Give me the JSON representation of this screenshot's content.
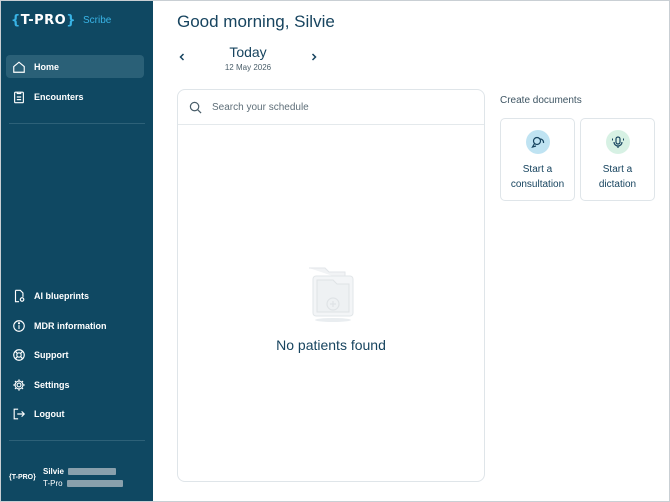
{
  "brand": {
    "logo": "T-PRO",
    "product": "Scribe"
  },
  "sidebar": {
    "top_items": [
      {
        "label": "Home",
        "icon": "home-icon",
        "active": true
      },
      {
        "label": "Encounters",
        "icon": "clipboard-icon",
        "active": false
      }
    ],
    "bottom_items": [
      {
        "label": "AI blueprints",
        "icon": "document-gear-icon"
      },
      {
        "label": "MDR information",
        "icon": "info-icon"
      },
      {
        "label": "Support",
        "icon": "lifebuoy-icon"
      },
      {
        "label": "Settings",
        "icon": "gear-icon"
      },
      {
        "label": "Logout",
        "icon": "logout-icon"
      }
    ],
    "user": {
      "logo": "T-PRO",
      "name": "Silvie",
      "org": "T-Pro"
    }
  },
  "header": {
    "greeting": "Good morning, Silvie"
  },
  "date_nav": {
    "title": "Today",
    "date": "12 May 2026"
  },
  "schedule": {
    "search_placeholder": "Search your schedule",
    "search_value": "",
    "empty_message": "No patients found"
  },
  "create": {
    "title": "Create documents",
    "cards": [
      {
        "label_line1": "Start a",
        "label_line2": "consultation",
        "icon": "consultation-icon",
        "color": "#bfe3f2"
      },
      {
        "label_line1": "Start a",
        "label_line2": "dictation",
        "icon": "microphone-icon",
        "color": "#d7f1e4"
      }
    ]
  },
  "colors": {
    "sidebar": "#0f4862",
    "accent": "#39b4e6",
    "text": "#17445f"
  }
}
